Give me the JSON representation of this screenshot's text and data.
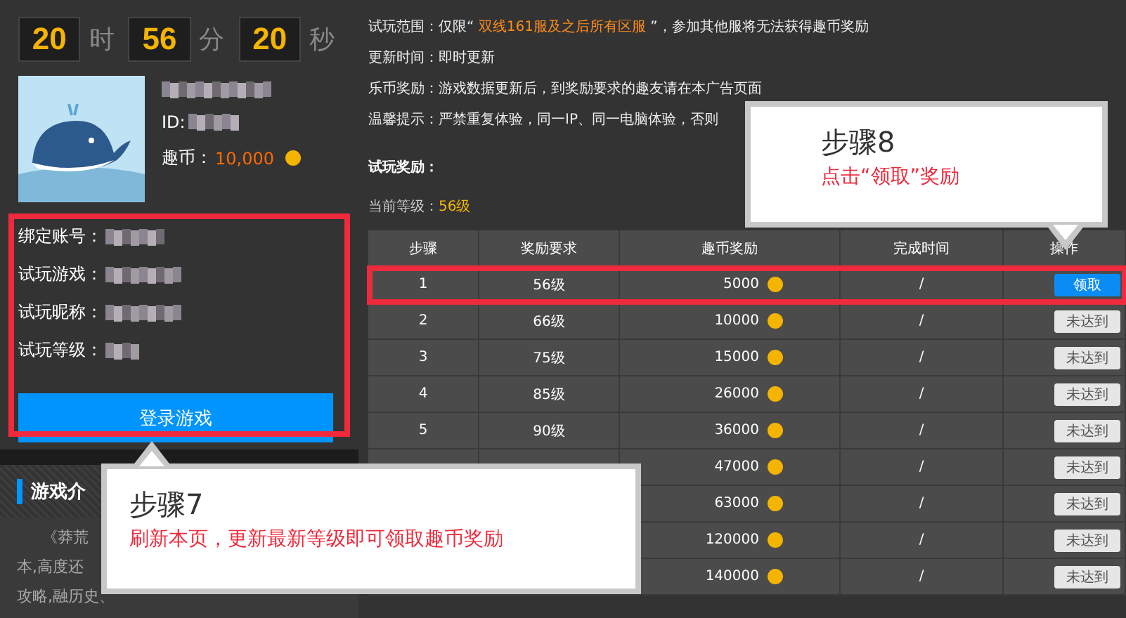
{
  "timer": [
    {
      "value": "20",
      "unit": "时"
    },
    {
      "value": "56",
      "unit": "分"
    },
    {
      "value": "20",
      "unit": "秒"
    }
  ],
  "profile": {
    "id_label": "ID:",
    "coins_label": "趣币：",
    "coins": "10,000"
  },
  "account": {
    "highlighted": true,
    "fields": [
      {
        "label": "绑定账号："
      },
      {
        "label": "试玩游戏："
      },
      {
        "label": "试玩昵称："
      },
      {
        "label": "试玩等级："
      }
    ],
    "login_button": "登录游戏"
  },
  "intro": {
    "title": "游戏介",
    "lines": [
      "《莽荒",
      "本,高度还",
      "攻略,融历史、"
    ]
  },
  "info": [
    {
      "label": "试玩范围：",
      "text": "仅限“ **双线161服及之后所有区服** ”，参加其他服将无法获得趣币奖励"
    },
    {
      "label": "更新时间：",
      "text": "即时更新"
    },
    {
      "label": "乐币奖励：",
      "text": "游戏数据更新后，到奖励要求的趣友请在本广告页面"
    },
    {
      "label": "温馨提示：",
      "text": "严禁重复体验，同一IP、同一电脑体验，否则"
    }
  ],
  "rewards_title": "试玩奖励：",
  "current_level": {
    "label": "当前等级：",
    "value": "56级"
  },
  "table": {
    "columns": [
      "步骤",
      "奖励要求",
      "趣币奖励",
      "完成时间",
      "操作"
    ],
    "rows": [
      {
        "step": "1",
        "level": "56级",
        "coins": "5000",
        "time": "/",
        "action": "领取",
        "kind": "claim",
        "highlighted": true
      },
      {
        "step": "2",
        "level": "66级",
        "coins": "10000",
        "time": "/",
        "action": "未达到",
        "kind": "locked",
        "highlighted": false
      },
      {
        "step": "3",
        "level": "75级",
        "coins": "15000",
        "time": "/",
        "action": "未达到",
        "kind": "locked",
        "highlighted": false
      },
      {
        "step": "4",
        "level": "85级",
        "coins": "26000",
        "time": "/",
        "action": "未达到",
        "kind": "locked",
        "highlighted": false
      },
      {
        "step": "5",
        "level": "90级",
        "coins": "36000",
        "time": "/",
        "action": "未达到",
        "kind": "locked",
        "highlighted": false
      },
      {
        "coins": "47000",
        "time": "/",
        "action": "未达到",
        "kind": "locked",
        "highlighted": false
      },
      {
        "coins": "63000",
        "time": "/",
        "action": "未达到",
        "kind": "locked",
        "highlighted": false
      },
      {
        "coins": "120000",
        "time": "/",
        "action": "未达到",
        "kind": "locked",
        "highlighted": false
      },
      {
        "coins": "140000",
        "time": "/",
        "action": "未达到",
        "kind": "locked",
        "highlighted": false
      }
    ]
  },
  "callouts": [
    {
      "title": "步骤7",
      "text": "刷新本页，更新最新等级即可领取趣币奖励",
      "kind": "up"
    },
    {
      "title": "步骤8",
      "text": "点击“领取”奖励",
      "kind": "down"
    }
  ]
}
